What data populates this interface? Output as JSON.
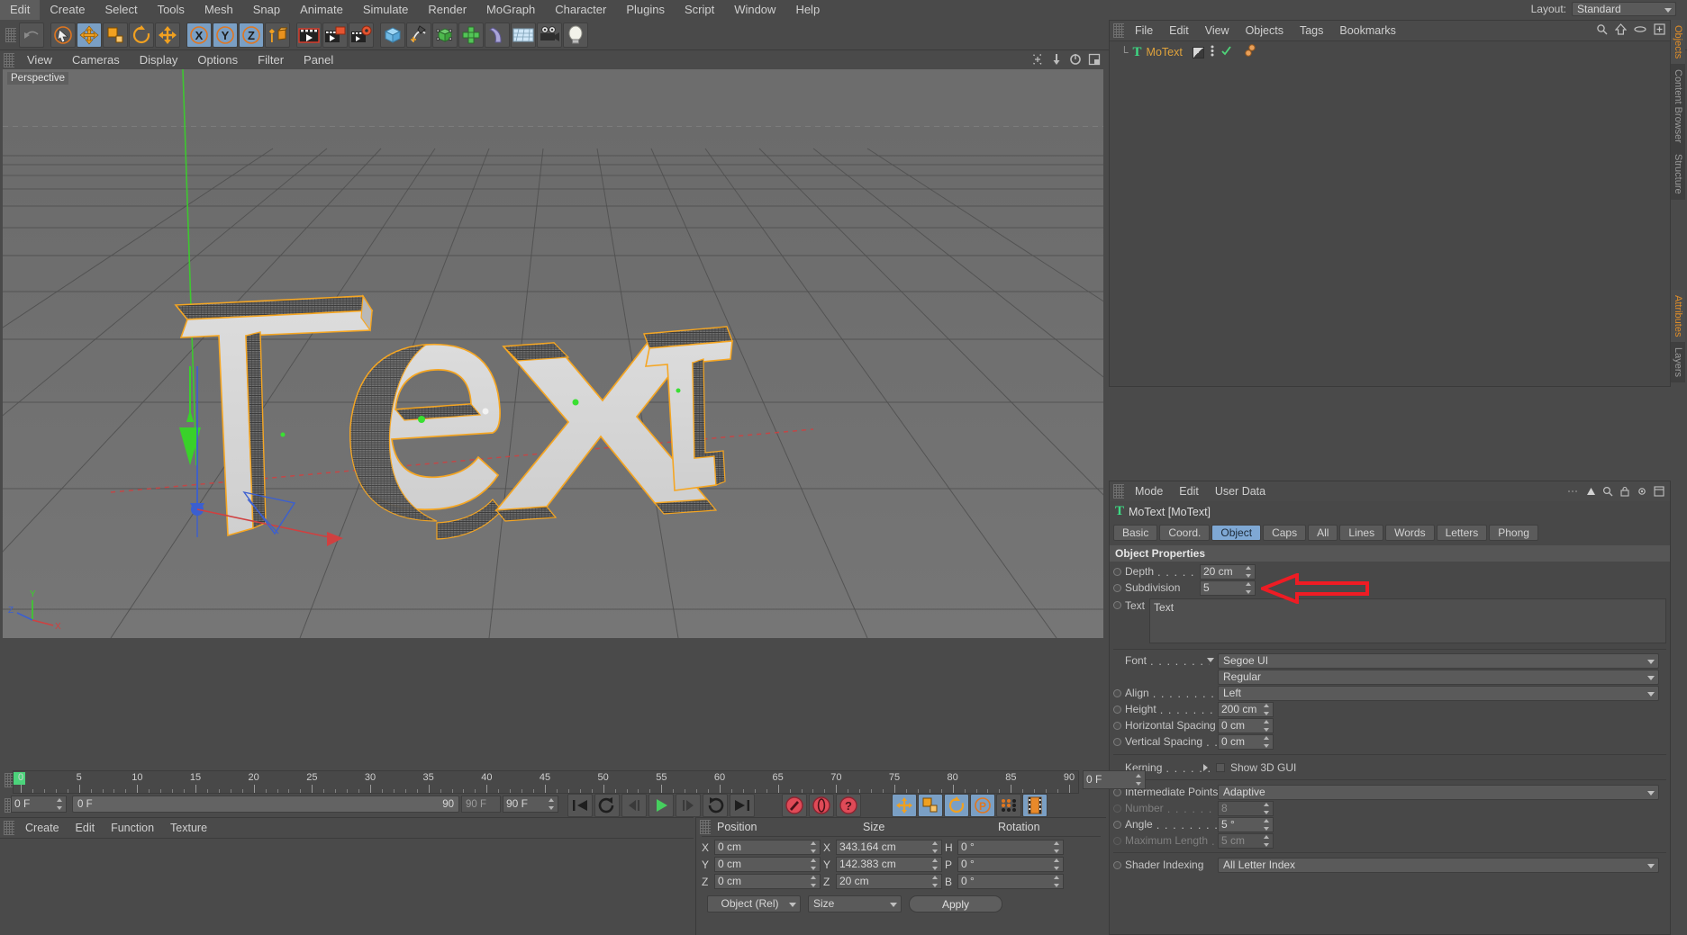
{
  "app": {
    "menus": [
      "Edit",
      "Create",
      "Select",
      "Tools",
      "Mesh",
      "Snap",
      "Animate",
      "Simulate",
      "Render",
      "MoGraph",
      "Character",
      "Plugins",
      "Script",
      "Window",
      "Help"
    ],
    "layout_label": "Layout:",
    "layout_value": "Standard"
  },
  "toolbar": {
    "groups": [
      {
        "name": "undo",
        "items": [
          {
            "icon": "undo-icon",
            "label": "Undo",
            "active": false
          }
        ]
      },
      {
        "name": "select-tools",
        "items": [
          {
            "icon": "cursor-select-icon",
            "label": "Live Selection",
            "active": false
          },
          {
            "icon": "move-icon",
            "label": "Move",
            "active": true
          },
          {
            "icon": "scale-icon",
            "label": "Scale",
            "active": false
          },
          {
            "icon": "rotate-icon",
            "label": "Rotate",
            "active": false
          },
          {
            "icon": "move-axis-icon",
            "label": "Move Axis",
            "active": false
          }
        ]
      },
      {
        "name": "axis-locks",
        "items": [
          {
            "icon": "axis-x-icon",
            "label": "X",
            "active": true
          },
          {
            "icon": "axis-y-icon",
            "label": "Y",
            "active": true
          },
          {
            "icon": "axis-z-icon",
            "label": "Z",
            "active": true
          },
          {
            "icon": "world-object-icon",
            "label": "World/Object",
            "active": false
          }
        ]
      },
      {
        "name": "render",
        "items": [
          {
            "icon": "render-view-icon",
            "label": "Render View",
            "active": false
          },
          {
            "icon": "render-picture-viewer-icon",
            "label": "Render to Picture Viewer",
            "active": false
          },
          {
            "icon": "render-settings-icon",
            "label": "Edit Render Settings",
            "active": false
          }
        ]
      },
      {
        "name": "objects",
        "items": [
          {
            "icon": "cube-primitive-icon",
            "label": "Add Cube",
            "active": false
          },
          {
            "icon": "spline-pen-icon",
            "label": "Add Spline",
            "active": false
          },
          {
            "icon": "nurbs-icon",
            "label": "Add NURBS",
            "active": false
          },
          {
            "icon": "array-icon",
            "label": "Add Array",
            "active": false
          },
          {
            "icon": "deformer-icon",
            "label": "Add Deformer",
            "active": false
          },
          {
            "icon": "environment-icon",
            "label": "Add Environment",
            "active": false
          },
          {
            "icon": "camera-icon",
            "label": "Add Camera",
            "active": false
          },
          {
            "icon": "light-icon",
            "label": "Add Light",
            "active": false
          }
        ]
      }
    ]
  },
  "viewport": {
    "menus": [
      "View",
      "Cameras",
      "Display",
      "Options",
      "Filter",
      "Panel"
    ],
    "label": "Perspective",
    "corner_icons": [
      "viewport-move-icon",
      "viewport-zoom-icon",
      "viewport-rotate-icon",
      "viewport-maximize-icon"
    ],
    "axis_gizmo": {
      "x": "X",
      "y": "Y",
      "z": "Z"
    },
    "scene_text": "Text"
  },
  "object_manager": {
    "menus": [
      "File",
      "Edit",
      "View",
      "Objects",
      "Tags",
      "Bookmarks"
    ],
    "header_icons": [
      "search-icon",
      "home-icon",
      "eye-icon",
      "newlayer-icon"
    ],
    "objects": [
      {
        "name": "MoText",
        "icon": "motext-icon",
        "tags": [
          "display-tag",
          "mograph-tag",
          "check-tag"
        ]
      }
    ]
  },
  "attribute_manager": {
    "menus": [
      "Mode",
      "Edit",
      "User Data"
    ],
    "object_title": "MoText [MoText]",
    "object_icon": "motext-icon",
    "tabs": [
      {
        "label": "Basic",
        "active": false
      },
      {
        "label": "Coord.",
        "active": false
      },
      {
        "label": "Object",
        "active": true
      },
      {
        "label": "Caps",
        "active": false
      },
      {
        "label": "All",
        "active": false
      },
      {
        "label": "Lines",
        "active": false
      },
      {
        "label": "Words",
        "active": false
      },
      {
        "label": "Letters",
        "active": false
      },
      {
        "label": "Phong",
        "active": false
      }
    ],
    "section_title": "Object Properties",
    "fields": {
      "depth_label": "Depth",
      "depth_value": "20 cm",
      "subdivision_label": "Subdivision",
      "subdivision_value": "5",
      "text_label": "Text",
      "text_value": "Text",
      "font_label": "Font",
      "font_value": "Segoe UI",
      "font_style_value": "Regular",
      "align_label": "Align",
      "align_value": "Left",
      "height_label": "Height",
      "height_value": "200 cm",
      "hspacing_label": "Horizontal Spacing",
      "hspacing_value": "0 cm",
      "vspacing_label": "Vertical Spacing",
      "vspacing_value": "0 cm",
      "kerning_label": "Kerning",
      "show3dgui_label": "Show 3D GUI",
      "show3dgui_checked": false,
      "intermediate_label": "Intermediate Points",
      "intermediate_value": "Adaptive",
      "number_label": "Number",
      "number_value": "8",
      "angle_label": "Angle",
      "angle_value": "5 °",
      "maxlength_label": "Maximum Length",
      "maxlength_value": "5 cm",
      "shader_label": "Shader Indexing",
      "shader_value": "All Letter Index"
    },
    "annotation": {
      "type": "red-arrow",
      "points_to": "subdivision-field",
      "color": "#ee1c24"
    }
  },
  "right_tabs": {
    "top": [
      {
        "label": "Objects",
        "active": true
      },
      {
        "label": "Content Browser",
        "active": false
      },
      {
        "label": "Structure",
        "active": false
      }
    ],
    "bottom": [
      {
        "label": "Attributes",
        "active": true
      },
      {
        "label": "Layers",
        "active": false
      }
    ]
  },
  "timeline": {
    "ticks": [
      "0",
      "5",
      "10",
      "15",
      "20",
      "25",
      "30",
      "35",
      "40",
      "45",
      "50",
      "55",
      "60",
      "65",
      "70",
      "75",
      "80",
      "85",
      "90"
    ],
    "current_frame_field": "0 F",
    "current_frame_left": "0 F",
    "range_start": "0 F",
    "range_end_label": "90 F",
    "range_end_field": "90 F",
    "slider_max_label": "90",
    "playhead_frame": 0,
    "transport": [
      {
        "icon": "go-to-start-icon",
        "label": "Go to Start"
      },
      {
        "icon": "prev-key-icon",
        "label": "Go to Previous Key"
      },
      {
        "icon": "step-back-icon",
        "label": "Go to Previous Frame"
      },
      {
        "icon": "play-icon",
        "label": "Play"
      },
      {
        "icon": "step-forward-icon",
        "label": "Go to Next Frame"
      },
      {
        "icon": "next-key-icon",
        "label": "Go to Next Key"
      },
      {
        "icon": "go-to-end-icon",
        "label": "Go to End"
      }
    ],
    "record": [
      {
        "icon": "record-key-icon",
        "label": "Record Active Objects"
      },
      {
        "icon": "autokey-icon",
        "label": "Autokeying"
      },
      {
        "icon": "keyframe-selection-icon",
        "label": "Keyframe Selection"
      }
    ],
    "toggles": [
      {
        "icon": "position-key-icon",
        "label": "Position",
        "active": true
      },
      {
        "icon": "scale-key-icon",
        "label": "Scale",
        "active": true
      },
      {
        "icon": "rotation-key-icon",
        "label": "Rotation",
        "active": true
      },
      {
        "icon": "param-key-icon",
        "label": "Parameter",
        "active": true
      },
      {
        "icon": "pla-key-icon",
        "label": "Point Level Animation",
        "active": false
      },
      {
        "icon": "filmstrip-icon",
        "label": "Animation Mode",
        "active": true
      }
    ]
  },
  "material_manager": {
    "menus": [
      "Create",
      "Edit",
      "Function",
      "Texture"
    ]
  },
  "coordinates": {
    "grip": "coordinates-grip",
    "columns": [
      "Position",
      "Size",
      "Rotation"
    ],
    "rows": [
      {
        "pos_axis": "X",
        "pos_value": "0 cm",
        "size_axis": "X",
        "size_value": "343.164 cm",
        "rot_axis": "H",
        "rot_value": "0 °"
      },
      {
        "pos_axis": "Y",
        "pos_value": "0 cm",
        "size_axis": "Y",
        "size_value": "142.383 cm",
        "rot_axis": "P",
        "rot_value": "0 °"
      },
      {
        "pos_axis": "Z",
        "pos_value": "0 cm",
        "size_axis": "Z",
        "size_value": "20 cm",
        "rot_axis": "B",
        "rot_value": "0 °"
      }
    ],
    "mode_value": "Object (Rel)",
    "size_mode_value": "Size",
    "apply_label": "Apply"
  },
  "colors": {
    "bg": "#4a4a4a",
    "panel": "#484848",
    "accent_blue": "#7fa8d4",
    "accent_orange": "#e08d28",
    "selection_orange": "#f5a623",
    "annotation_red": "#ee1c24",
    "green_axis": "#39d12a"
  }
}
